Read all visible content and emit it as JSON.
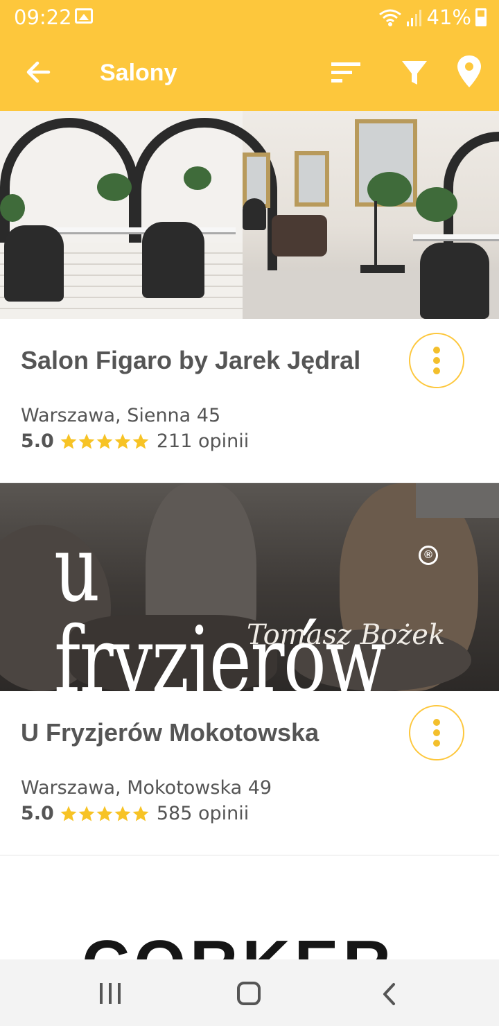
{
  "status_bar": {
    "time": "09:22",
    "battery": "41%",
    "icons": [
      "gallery-icon",
      "wifi-icon",
      "signal-icon",
      "battery-icon"
    ]
  },
  "app_bar": {
    "title": "Salony",
    "actions": [
      "sort-icon",
      "filter-icon",
      "location-pin-icon"
    ]
  },
  "colors": {
    "primary": "#fdc73c",
    "star": "#f7c325",
    "text": "#555555"
  },
  "salons": [
    {
      "name": "Salon Figaro by Jarek Jędral",
      "address": "Warszawa, Sienna 45",
      "rating": "5.0",
      "stars": 5,
      "reviews": "211 opinii"
    },
    {
      "name": "U Fryzjerów Mokotowska",
      "address": "Warszawa, Mokotowska 49",
      "rating": "5.0",
      "stars": 5,
      "reviews": "585 opinii",
      "logo_text": "u fryzjerów",
      "logo_subtext": "Tomasz Bożek",
      "logo_mark": "®"
    },
    {
      "logo_text": "CORKER"
    }
  ],
  "nav_bar": {
    "icons": [
      "recent-apps-icon",
      "home-icon",
      "back-icon"
    ]
  }
}
